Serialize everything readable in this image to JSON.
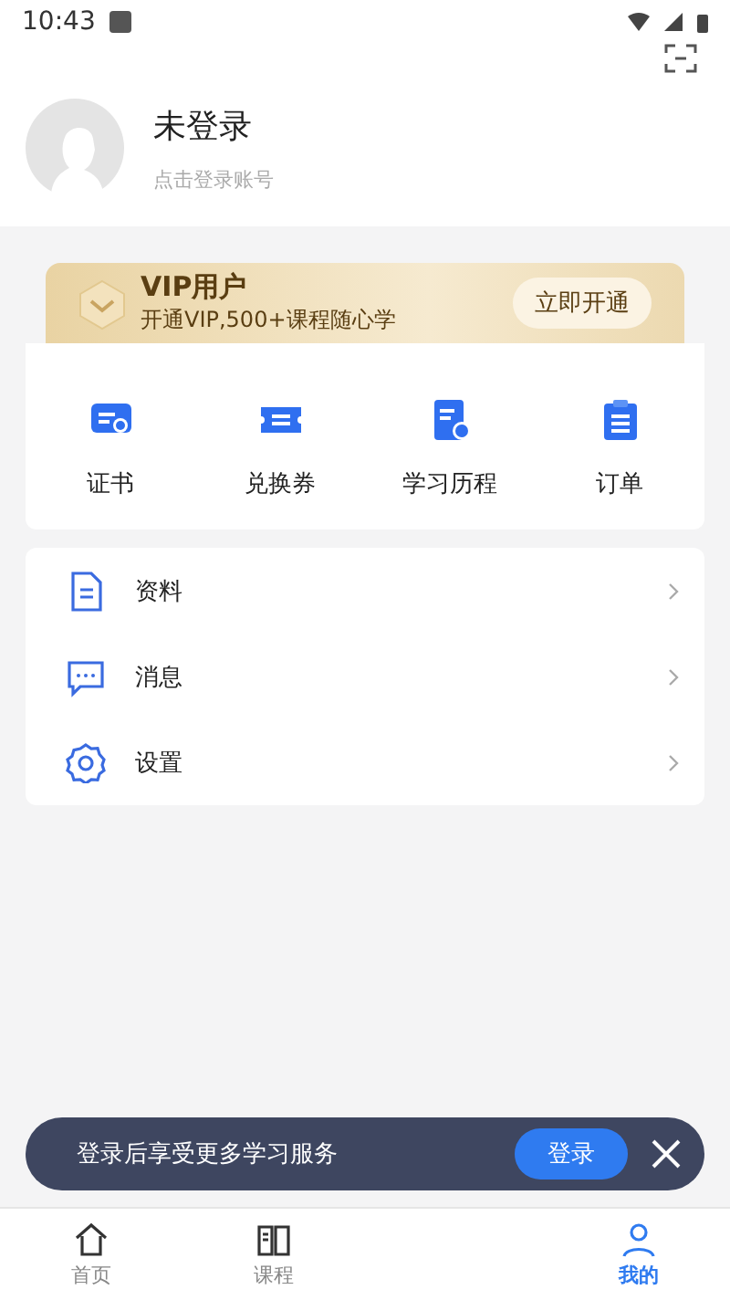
{
  "status_bar": {
    "time": "10:43"
  },
  "profile": {
    "name": "未登录",
    "hint": "点击登录账号"
  },
  "vip": {
    "title": "VIP用户",
    "subtitle": "开通VIP,500+课程随心学",
    "button": "立即开通"
  },
  "shortcuts": [
    {
      "kind": "certificate",
      "label": "证书"
    },
    {
      "kind": "ticket",
      "label": "兑换券"
    },
    {
      "kind": "history",
      "label": "学习历程"
    },
    {
      "kind": "order",
      "label": "订单"
    }
  ],
  "menu": [
    {
      "kind": "document",
      "label": "资料"
    },
    {
      "kind": "message",
      "label": "消息"
    },
    {
      "kind": "settings",
      "label": "设置"
    }
  ],
  "toast": {
    "text": "登录后享受更多学习服务",
    "button": "登录"
  },
  "tabs": [
    {
      "kind": "home",
      "label": "首页",
      "selected": false
    },
    {
      "kind": "course",
      "label": "课程",
      "selected": false
    },
    {
      "kind": "me",
      "label": "我的",
      "selected": true
    }
  ]
}
